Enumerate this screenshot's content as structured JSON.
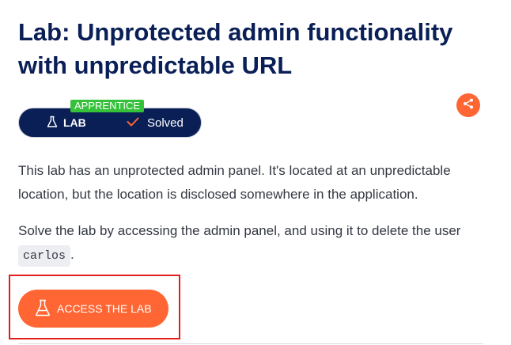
{
  "header": {
    "title": "Lab: Unprotected admin functionality with unpredictable URL"
  },
  "status": {
    "level_tag": "APPRENTICE",
    "lab_label": "LAB",
    "solved_label": "Solved",
    "pill_color": "#0a1f56",
    "level_color": "#35c13a",
    "check_color": "#ff6633"
  },
  "share": {
    "icon": "share-icon",
    "color": "#ff6633"
  },
  "description": {
    "paragraph1": "This lab has an unprotected admin panel. It's located at an unpredictable location, but the location is disclosed somewhere in the application.",
    "paragraph2_prefix": "Solve the lab by accessing the admin panel, and using it to delete the user ",
    "username": "carlos",
    "paragraph2_suffix": "."
  },
  "action": {
    "access_label": "ACCESS THE LAB",
    "button_color": "#ff6633",
    "highlight_color": "#e21d1d"
  }
}
